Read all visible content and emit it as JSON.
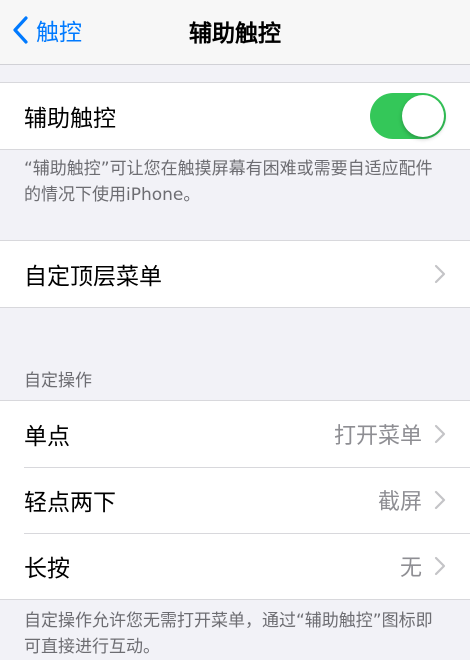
{
  "nav": {
    "back_label": "触控",
    "title": "辅助触控"
  },
  "assistive_touch": {
    "label": "辅助触控",
    "enabled": true,
    "footer": "“辅助触控”可让您在触摸屏幕有困难或需要自适应配件的情况下使用iPhone。"
  },
  "top_menu": {
    "label": "自定顶层菜单"
  },
  "custom_actions": {
    "header": "自定操作",
    "items": [
      {
        "label": "单点",
        "value": "打开菜单"
      },
      {
        "label": "轻点两下",
        "value": "截屏"
      },
      {
        "label": "长按",
        "value": "无"
      }
    ],
    "footer": "自定操作允许您无需打开菜单，通过“辅助触控”图标即可直接进行互动。"
  },
  "colors": {
    "accent": "#007aff",
    "toggle_on": "#34c759"
  }
}
